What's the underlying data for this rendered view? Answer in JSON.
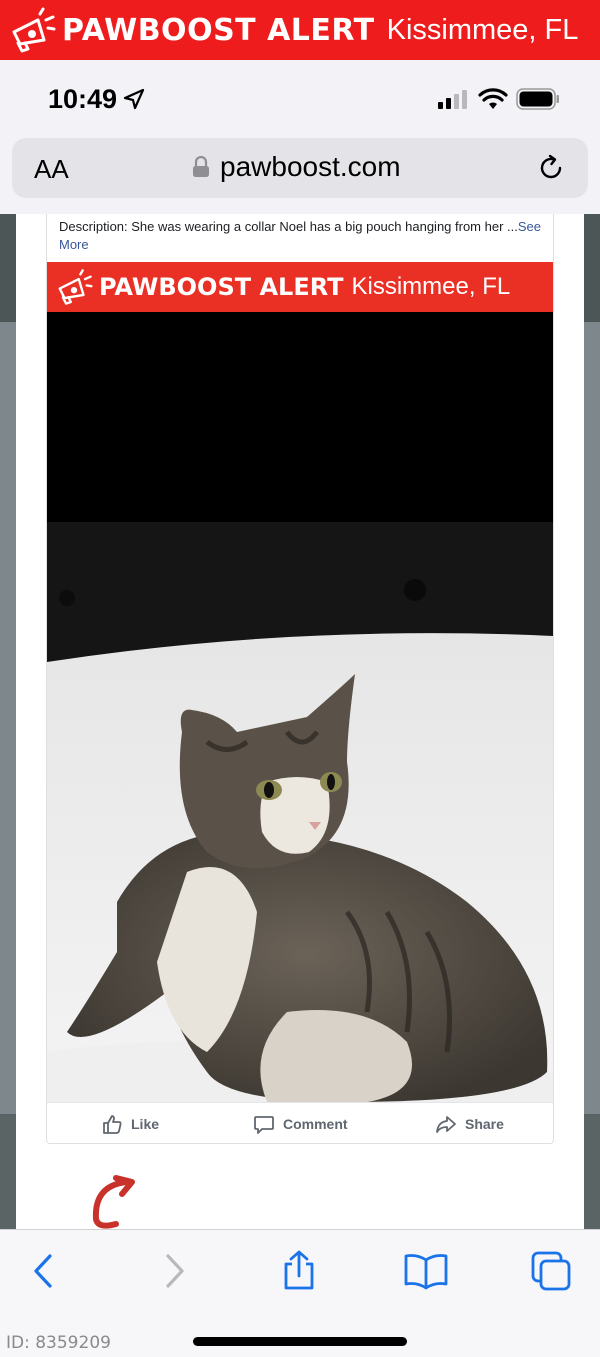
{
  "top_banner": {
    "brand": "PAWBOOST ALERT",
    "location": "Kissimmee, FL",
    "icon": "megaphone-icon",
    "color": "#ee1c1c"
  },
  "status_bar": {
    "time": "10:49"
  },
  "browser": {
    "text_size_label": "AA",
    "domain": "pawboost.com"
  },
  "post": {
    "description": "Description: She was wearing a collar Noel has a big pouch hanging from her ...",
    "see_more": "See More",
    "alert_brand": "PAWBOOST ALERT",
    "alert_location": "Kissimmee, FL",
    "actions": {
      "like": "Like",
      "comment": "Comment",
      "share": "Share"
    }
  },
  "footer": {
    "id_label": "ID: 8359209"
  }
}
